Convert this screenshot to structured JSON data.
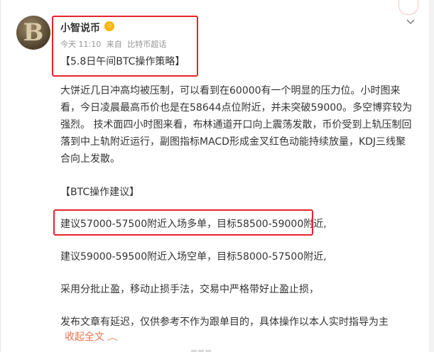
{
  "post": {
    "username": "小智说币",
    "meta": {
      "time": "今天 11:10",
      "from": "来自",
      "source": "比特币超话"
    },
    "title": "【5.8日午间BTC操作策略】",
    "paragraphs": [
      "大饼近几日冲高均被压制，可以看到在60000有一个明显的压力位。小时图来看，今日凌晨最高币价也是在58644点位附近，并未突破59000。多空博弈较为强烈。 技术面四小时图来看，布林通道开口向上震荡发散，币价受到上轨压制回落到中上轨附近运行，副图指标MACD形成金叉红色动能持续放量，KDJ三线聚合向上发散。"
    ],
    "advice_heading": "【BTC操作建议】",
    "advice": [
      "建议57000-57500附近入场多单，目标58500-59000附近,",
      "建议59000-59500附近入场空单，目标58000-57500附近,",
      "采用分批止盈，移动止损手法，交易中严格带好止盈止损，",
      "发布文章有延迟，仅供参考不作为跟单目的，具体操作以本人实时指导为主"
    ],
    "collapse_label": "收起全文"
  },
  "icons": {
    "avatar": "bitcoin-avatar-icon",
    "vip": "vip-badge-icon",
    "dropdown": "chevron-down-icon",
    "collapse": "chevron-up-icon"
  },
  "colors": {
    "highlight_border": "#e8232d",
    "link_orange": "#eb7350",
    "meta_gray": "#939393"
  }
}
